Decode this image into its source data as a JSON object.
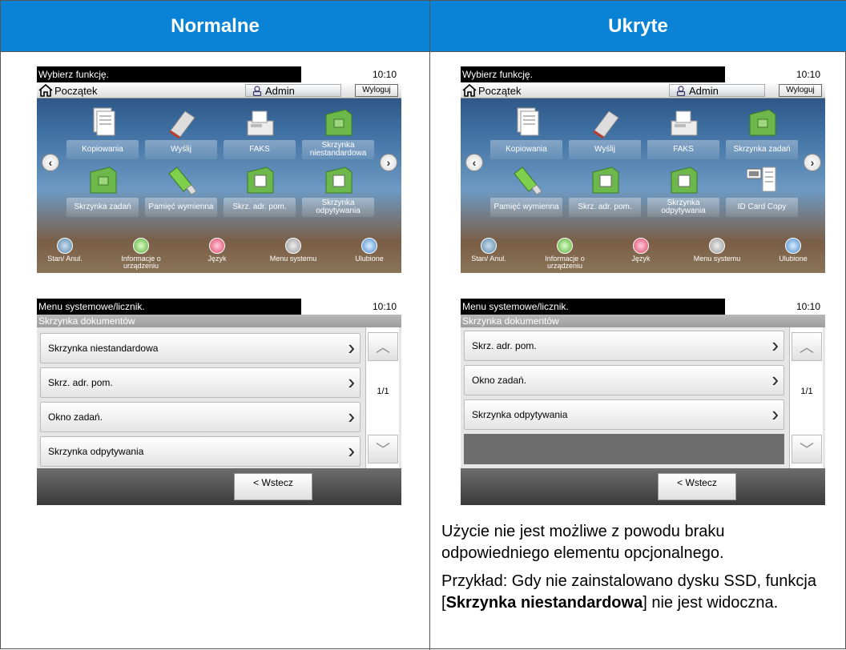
{
  "headers": {
    "left": "Normalne",
    "right": "Ukryte"
  },
  "left_home": {
    "title": "Wybierz funkcję.",
    "clock": "10:10",
    "home_label": "Początek",
    "admin_label": "Admin",
    "logout_label": "Wyloguj",
    "functions": [
      "Kopiowania",
      "Wyślij",
      "FAKS",
      "Skrzynka niestandardowa",
      "Skrzynka zadań",
      "Pamięć wymienna",
      "Skrz. adr. pom.",
      "Skrzynka odpytywania"
    ],
    "dock": [
      "Stan/ Anul.",
      "Informacje o urządzeniu",
      "Język",
      "Menu systemu",
      "Ulubione"
    ]
  },
  "right_home": {
    "title": "Wybierz funkcję.",
    "clock": "10:10",
    "home_label": "Początek",
    "admin_label": "Admin",
    "logout_label": "Wyloguj",
    "functions": [
      "Kopiowania",
      "Wyślij",
      "FAKS",
      "Skrzynka zadań",
      "Pamięć wymienna",
      "Skrz. adr. pom.",
      "Skrzynka odpytywania",
      "ID Card Copy"
    ],
    "dock": [
      "Stan/ Anul.",
      "Informacje o urządzeniu",
      "Język",
      "Menu systemu",
      "Ulubione"
    ]
  },
  "left_menu": {
    "title": "Menu systemowe/licznik.",
    "clock": "10:10",
    "breadcrumb": "Skrzynka dokumentów",
    "items": [
      "Skrzynka niestandardowa",
      "Skrz. adr. pom.",
      "Okno zadań.",
      "Skrzynka odpytywania"
    ],
    "page": "1/1",
    "back_label": "< Wstecz"
  },
  "right_menu": {
    "title": "Menu systemowe/licznik.",
    "clock": "10:10",
    "breadcrumb": "Skrzynka dokumentów",
    "items": [
      "Skrz. adr. pom.",
      "Okno zadań.",
      "Skrzynka odpytywania"
    ],
    "page": "1/1",
    "back_label": "< Wstecz"
  },
  "note": {
    "para1": "Użycie nie jest możliwe z powodu braku odpowiedniego elementu opcjonalnego.",
    "para2_prefix": "Przykład: Gdy nie zainstalowano dysku SSD, funkcja [",
    "para2_bold": "Skrzynka niestandardowa",
    "para2_suffix": "] nie jest widoczna."
  },
  "colors": {
    "header_blue": "#0a83d6"
  }
}
